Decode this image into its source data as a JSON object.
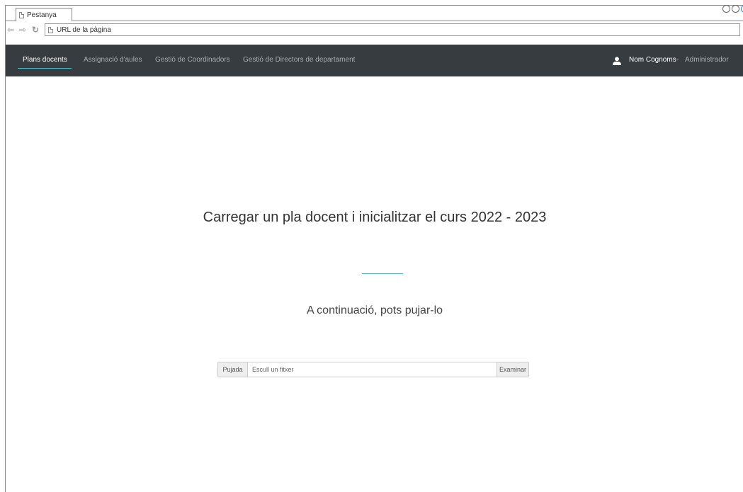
{
  "browser": {
    "tab_title": "Pestanya",
    "url": "URL de la pàgina"
  },
  "navbar": {
    "items": [
      {
        "label": "Plans docents",
        "active": true
      },
      {
        "label": "Assignació d'aules",
        "active": false
      },
      {
        "label": "Gestió de Coordinadors",
        "active": false
      },
      {
        "label": "Gestió de Directors de departament",
        "active": false
      }
    ],
    "user": {
      "name": "Nom Cognoms",
      "separator": "-",
      "role": "Administrador"
    }
  },
  "main": {
    "title": "Carregar un pla docent i inicialitzar el curs 2022 - 2023",
    "subtitle": "A continuació, pots pujar-lo",
    "upload": {
      "label": "Pujada",
      "placeholder": "Escull un fitxer",
      "browse_label": "Examinar"
    }
  },
  "colors": {
    "navbar_bg": "#363c40",
    "accent": "#52b9c9"
  }
}
